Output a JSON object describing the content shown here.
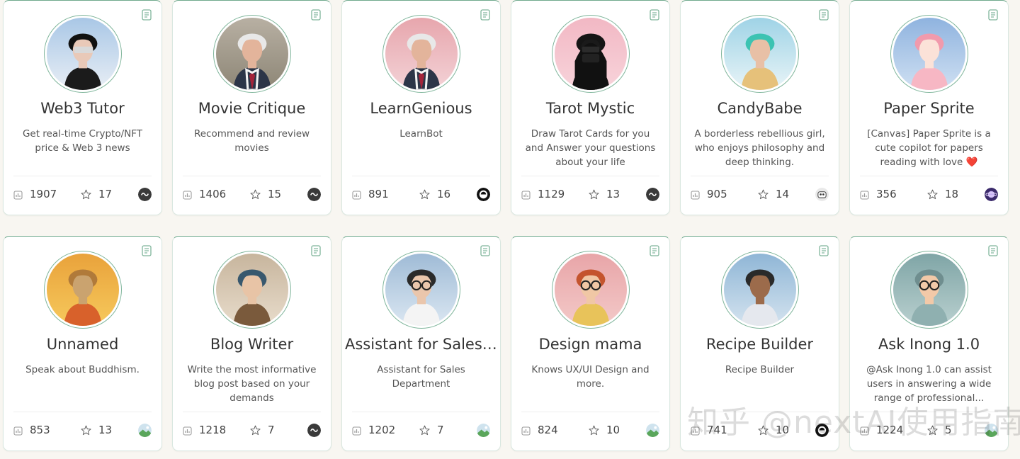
{
  "cards": [
    {
      "title": "Web3 Tutor",
      "desc": "Get real-time Crypto/NFT price & Web 3 news",
      "uses": "1907",
      "stars": "17",
      "model_icon": "gpt-dark-icon",
      "avatar_icon": "web3-tutor-avatar"
    },
    {
      "title": "Movie Critique",
      "desc": "Recommend and review movies",
      "uses": "1406",
      "stars": "15",
      "model_icon": "gpt-dark-icon",
      "avatar_icon": "movie-critique-avatar"
    },
    {
      "title": "LearnGenious",
      "desc": "LearnBot",
      "uses": "891",
      "stars": "16",
      "model_icon": "openai-icon",
      "avatar_icon": "learngenious-avatar"
    },
    {
      "title": "Tarot Mystic",
      "desc": "Draw Tarot Cards for you and Answer your questions about your life",
      "uses": "1129",
      "stars": "13",
      "model_icon": "gpt-dark-icon",
      "avatar_icon": "tarot-mystic-avatar"
    },
    {
      "title": "CandyBabe",
      "desc": "A borderless rebellious girl, who enjoys philosophy and deep thinking.",
      "uses": "905",
      "stars": "14",
      "model_icon": "robot-face-icon",
      "avatar_icon": "candybabe-avatar"
    },
    {
      "title": "Paper Sprite",
      "desc": "[Canvas] Paper Sprite is a cute copilot for papers reading with love ❤️",
      "uses": "356",
      "stars": "18",
      "model_icon": "purple-planet-icon",
      "avatar_icon": "paper-sprite-avatar"
    },
    {
      "title": "Unnamed",
      "desc": "Speak about Buddhism.",
      "uses": "853",
      "stars": "13",
      "model_icon": "landscape-icon",
      "avatar_icon": "unnamed-buddha-avatar"
    },
    {
      "title": "Blog Writer",
      "desc": "Write the most informative blog post based on your demands",
      "uses": "1218",
      "stars": "7",
      "model_icon": "gpt-dark-icon",
      "avatar_icon": "blog-writer-avatar"
    },
    {
      "title": "Assistant for Sales D...",
      "desc": "Assistant for Sales Department",
      "uses": "1202",
      "stars": "7",
      "model_icon": "landscape-icon",
      "avatar_icon": "sales-assistant-avatar"
    },
    {
      "title": "Design mama",
      "desc": "Knows UX/UI Design and more.",
      "uses": "824",
      "stars": "10",
      "model_icon": "landscape-icon",
      "avatar_icon": "design-mama-avatar"
    },
    {
      "title": "Recipe Builder",
      "desc": "Recipe Builder",
      "uses": "741",
      "stars": "10",
      "model_icon": "openai-icon",
      "avatar_icon": "recipe-builder-avatar"
    },
    {
      "title": "Ask Inong 1.0",
      "desc": "@Ask Inong 1.0 can assist users in answering a wide range of professional...",
      "uses": "1224",
      "stars": "5",
      "model_icon": "landscape-icon",
      "avatar_icon": "ask-inong-avatar"
    }
  ],
  "watermark": "知乎 @nextAI使用指南"
}
